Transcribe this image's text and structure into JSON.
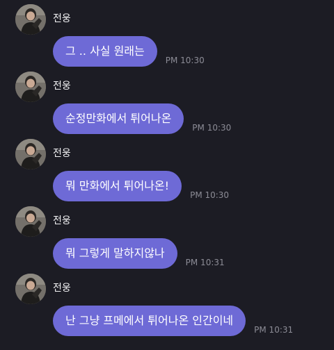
{
  "messages": [
    {
      "sender": "전웅",
      "text": "그 .. 사실 원래는",
      "time": "PM 10:30"
    },
    {
      "sender": "전웅",
      "text": "순정만화에서 튀어나온",
      "time": "PM 10:30"
    },
    {
      "sender": "전웅",
      "text": "뭐 만화에서 튀어나온!",
      "time": "PM 10:30"
    },
    {
      "sender": "전웅",
      "text": "뭐 그렇게 말하지않나",
      "time": "PM 10:31"
    },
    {
      "sender": "전웅",
      "text": "난 그냥 프메에서 튀어나온 인간이네",
      "time": "PM 10:31"
    }
  ],
  "colors": {
    "background": "#1c1c24",
    "bubble": "#6e6ad6",
    "timestamp": "#8c8c96"
  }
}
